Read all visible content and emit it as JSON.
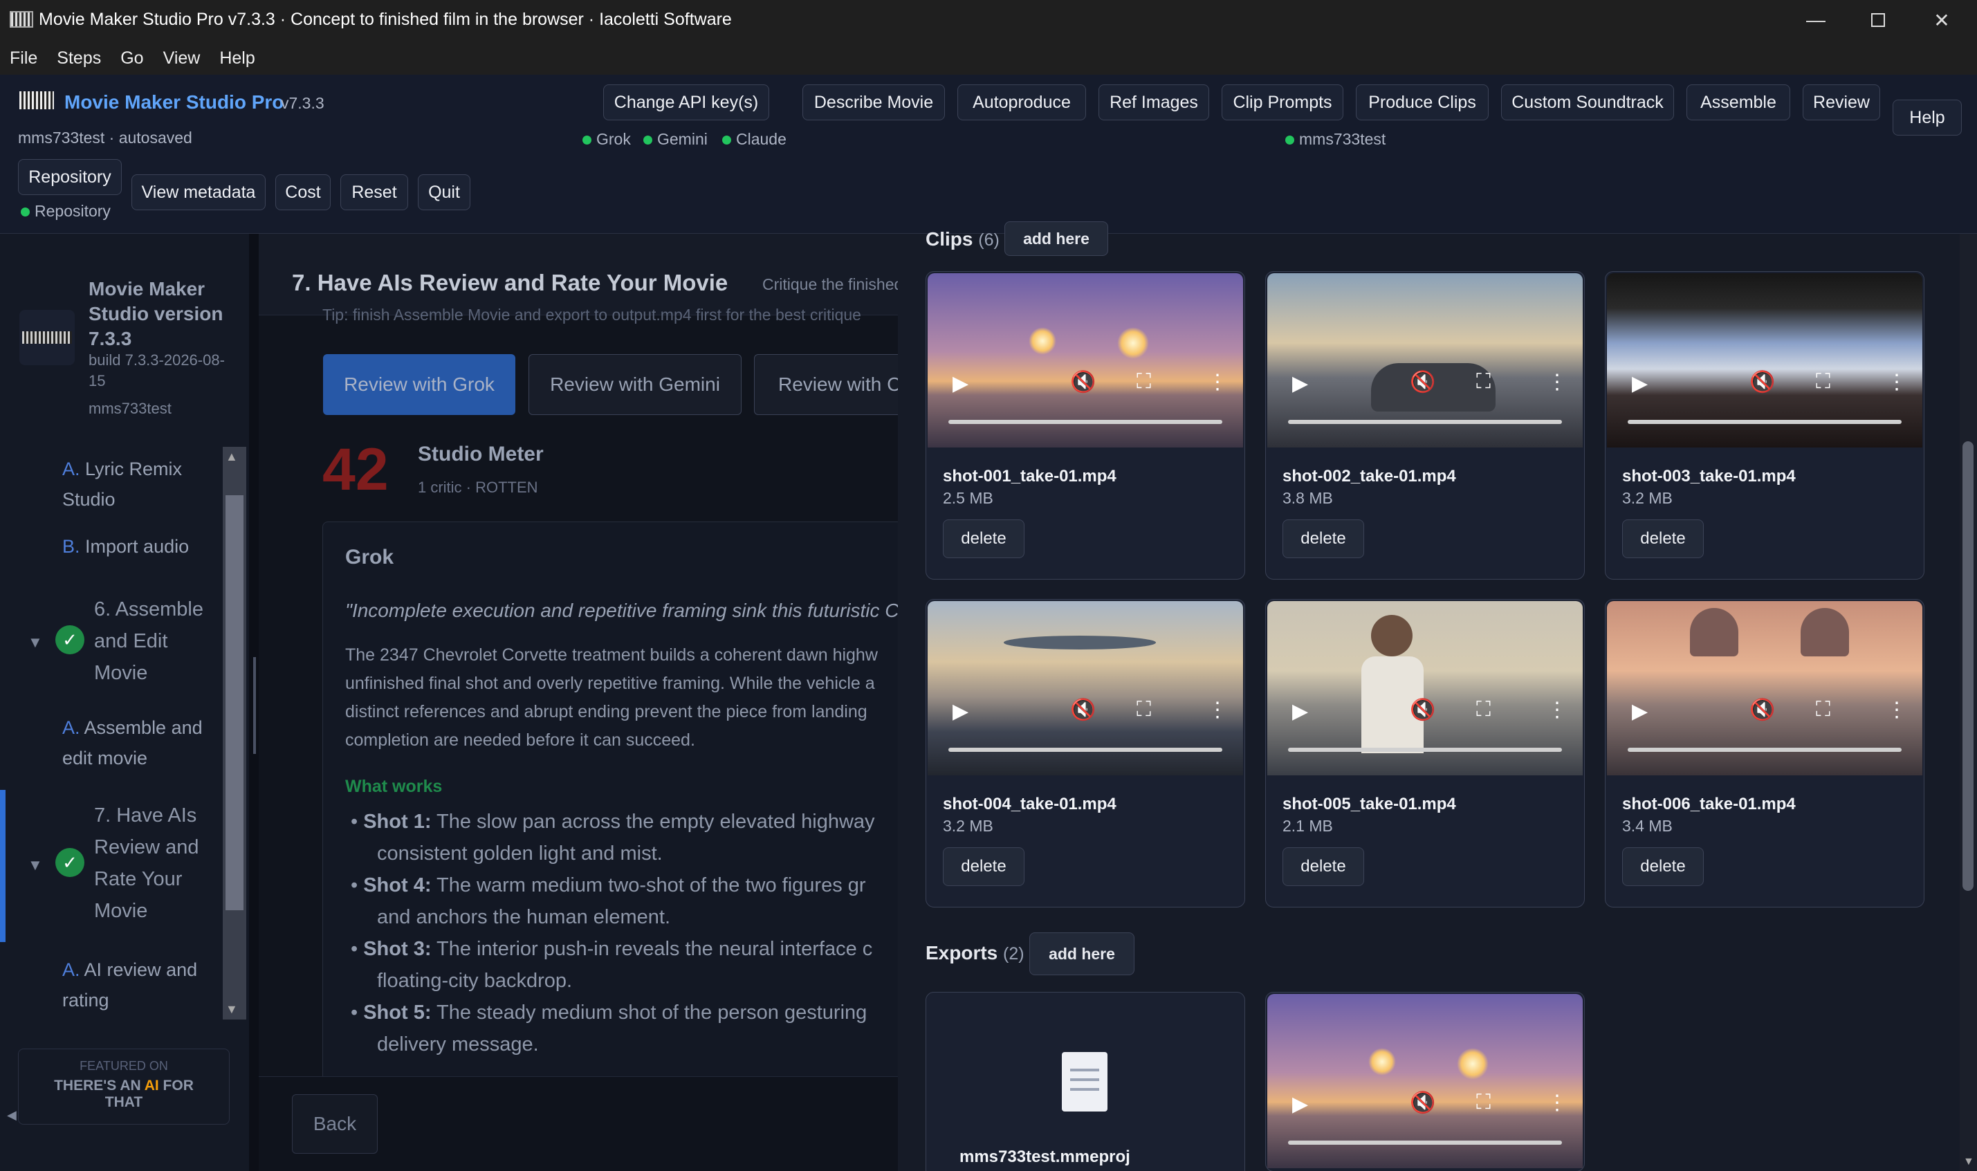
{
  "window": {
    "title": "Movie Maker Studio Pro v7.3.3 · Concept to finished film in the browser · Iacoletti Software"
  },
  "menu": [
    "File",
    "Steps",
    "Go",
    "View",
    "Help"
  ],
  "header": {
    "app_name": "Movie Maker Studio Pro",
    "version": "v7.3.3",
    "project_status": "mms733test · autosaved",
    "change_api": "Change API key(s)",
    "providers": [
      "Grok",
      "Gemini",
      "Claude"
    ],
    "steps": [
      "Describe Movie",
      "Autoproduce",
      "Ref Images",
      "Clip Prompts",
      "Produce Clips",
      "Custom Soundtrack",
      "Assemble",
      "Review"
    ],
    "project_indicator": "mms733test",
    "help": "Help",
    "repository": "Repository",
    "repository_status": "Repository",
    "actions": [
      "View metadata",
      "Cost",
      "Reset",
      "Quit"
    ]
  },
  "sidebar": {
    "app_title": "Movie Maker Studio version 7.3.3",
    "build": "build 7.3.3-2026-08-15",
    "project": "mms733test",
    "items": [
      {
        "letter": "A.",
        "label": "Lyric Remix Studio"
      },
      {
        "letter": "B.",
        "label": "Import audio"
      },
      {
        "step": "6. Assemble and Edit Movie"
      },
      {
        "letter": "A.",
        "label": "Assemble and edit movie"
      },
      {
        "step": "7. Have AIs Review and Rate Your Movie"
      },
      {
        "letter": "A.",
        "label": "AI review and rating"
      }
    ],
    "featured_top": "FEATURED ON",
    "featured_a": "THERE'S AN ",
    "featured_ai": "AI",
    "featured_b": " FOR",
    "featured_c": "THAT"
  },
  "main": {
    "title": "7. Have AIs Review and Rate Your Movie",
    "subtitle": "Critique the finished",
    "hint": "Tip: finish Assemble Movie and export to output.mp4 first for the best critique",
    "review_buttons": [
      "Review with Grok",
      "Review with Gemini",
      "Review with C"
    ],
    "score": "42",
    "meter_title": "Studio Meter",
    "meter_sub": "1 critic · ROTTEN",
    "critic": "Grok",
    "quote": "\"Incomplete execution and repetitive framing sink this futuristic Co",
    "body_lines": [
      "The 2347 Chevrolet Corvette treatment builds a coherent dawn highw",
      "unfinished final shot and overly repetitive framing. While the vehicle a",
      "distinct references and abrupt ending prevent the piece from landing",
      "completion are needed before it can succeed."
    ],
    "works_heading": "What works",
    "works": [
      {
        "shot": "Shot 1:",
        "line1": " The slow pan across the empty elevated highway",
        "line2": "consistent golden light and mist."
      },
      {
        "shot": "Shot 4:",
        "line1": " The warm medium two-shot of the two figures gr",
        "line2": "and anchors the human element."
      },
      {
        "shot": "Shot 3:",
        "line1": " The interior push-in reveals the neural interface c",
        "line2": "floating-city backdrop."
      },
      {
        "shot": "Shot 5:",
        "line1": " The steady medium shot of the person gesturing",
        "line2": "delivery message."
      }
    ],
    "back": "Back"
  },
  "clips": {
    "heading": "Clips",
    "count": "(6)",
    "add_here": "add here",
    "items": [
      {
        "name": "shot-001_take-01.mp4",
        "size": "2.5 MB",
        "delete": "delete"
      },
      {
        "name": "shot-002_take-01.mp4",
        "size": "3.8 MB",
        "delete": "delete"
      },
      {
        "name": "shot-003_take-01.mp4",
        "size": "3.2 MB",
        "delete": "delete"
      },
      {
        "name": "shot-004_take-01.mp4",
        "size": "3.2 MB",
        "delete": "delete"
      },
      {
        "name": "shot-005_take-01.mp4",
        "size": "2.1 MB",
        "delete": "delete"
      },
      {
        "name": "shot-006_take-01.mp4",
        "size": "3.4 MB",
        "delete": "delete"
      }
    ]
  },
  "exports": {
    "heading": "Exports",
    "count": "(2)",
    "add_here": "add here",
    "file": "mms733test.mmeproj"
  },
  "colors": {
    "accent": "#2f6fd6",
    "success": "#22c55e",
    "score": "#b91c1c",
    "works": "#22c55e",
    "brand": "#60a5fa"
  }
}
